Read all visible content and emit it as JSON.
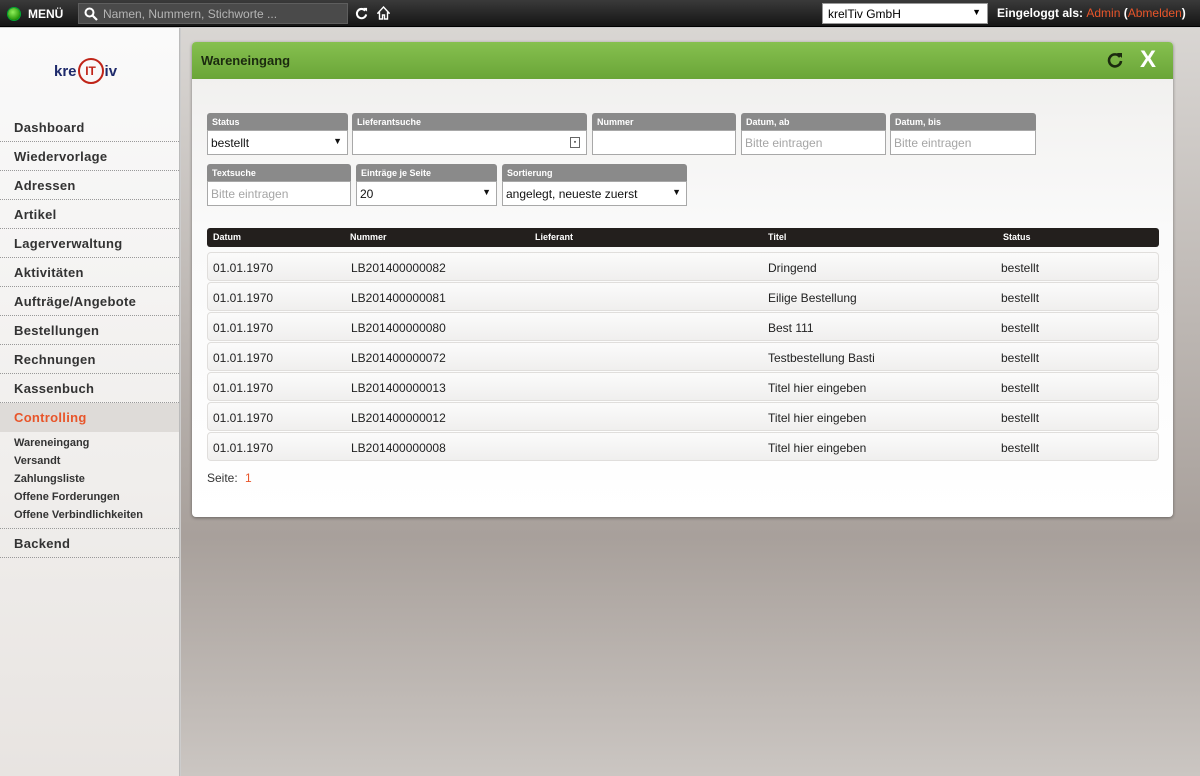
{
  "topbar": {
    "menu_label": "MENÜ",
    "search_placeholder": "Namen, Nummern, Stichworte ...",
    "company": "krelTiv GmbH",
    "logged_in_label": "Eingeloggt als:",
    "user": "Admin",
    "logout_open": "(",
    "logout_label": "Abmelden",
    "logout_close": ")"
  },
  "sidebar": {
    "logo_left": "kre",
    "logo_mid": "IT",
    "logo_right": "iv",
    "items": [
      {
        "label": "Dashboard"
      },
      {
        "label": "Wiedervorlage"
      },
      {
        "label": "Adressen"
      },
      {
        "label": "Artikel"
      },
      {
        "label": "Lagerverwaltung"
      },
      {
        "label": "Aktivitäten"
      },
      {
        "label": "Aufträge/Angebote"
      },
      {
        "label": "Bestellungen"
      },
      {
        "label": "Rechnungen"
      },
      {
        "label": "Kassenbuch"
      },
      {
        "label": "Controlling"
      }
    ],
    "subitems": [
      {
        "label": "Wareneingang"
      },
      {
        "label": "Versandt"
      },
      {
        "label": "Zahlungsliste"
      },
      {
        "label": "Offene Forderungen"
      },
      {
        "label": "Offene Verbindlichkeiten"
      }
    ],
    "backend": "Backend"
  },
  "panel": {
    "title": "Wareneingang",
    "filters": {
      "status_label": "Status",
      "status_value": "bestellt",
      "supplier_label": "Lieferantsuche",
      "number_label": "Nummer",
      "date_from_label": "Datum, ab",
      "date_from_placeholder": "Bitte eintragen",
      "date_to_label": "Datum, bis",
      "date_to_placeholder": "Bitte eintragen",
      "text_label": "Textsuche",
      "text_placeholder": "Bitte eintragen",
      "per_page_label": "Einträge je Seite",
      "per_page_value": "20",
      "sort_label": "Sortierung",
      "sort_value": "angelegt, neueste zuerst"
    },
    "table": {
      "headers": [
        "Datum",
        "Nummer",
        "Lieferant",
        "Titel",
        "Status"
      ],
      "rows": [
        [
          "01.01.1970",
          "LB201400000082",
          "",
          "Dringend",
          "bestellt"
        ],
        [
          "01.01.1970",
          "LB201400000081",
          "",
          "Eilige Bestellung",
          "bestellt"
        ],
        [
          "01.01.1970",
          "LB201400000080",
          "",
          "Best 111",
          "bestellt"
        ],
        [
          "01.01.1970",
          "LB201400000072",
          "",
          "Testbestellung Basti",
          "bestellt"
        ],
        [
          "01.01.1970",
          "LB201400000013",
          "",
          "Titel hier eingeben",
          "bestellt"
        ],
        [
          "01.01.1970",
          "LB201400000012",
          "",
          "Titel hier eingeben",
          "bestellt"
        ],
        [
          "01.01.1970",
          "LB201400000008",
          "",
          "Titel hier eingeben",
          "bestellt"
        ]
      ]
    },
    "pager_label": "Seite:",
    "pager_page": "1"
  }
}
